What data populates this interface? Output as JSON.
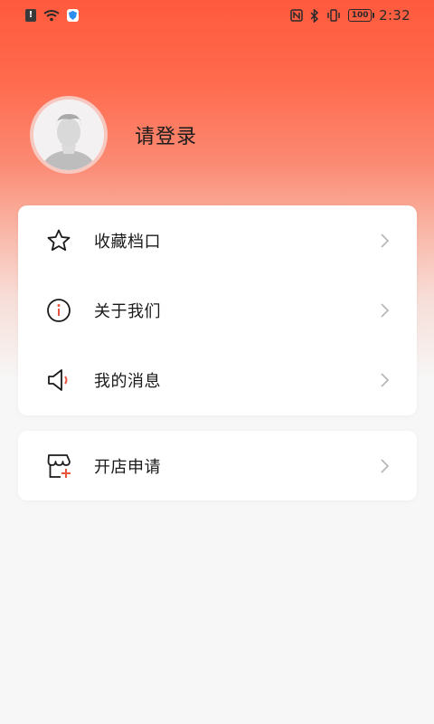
{
  "status_bar": {
    "alert_glyph": "!",
    "battery": "100",
    "time": "2:32"
  },
  "profile": {
    "login_label": "请登录"
  },
  "menu": {
    "items": [
      {
        "label": "收藏档口",
        "icon": "star-icon"
      },
      {
        "label": "关于我们",
        "icon": "info-circle-icon"
      },
      {
        "label": "我的消息",
        "icon": "speaker-icon"
      }
    ],
    "shop_apply": {
      "label": "开店申请",
      "icon": "store-add-icon"
    }
  },
  "colors": {
    "hero_top": "#ff5a3d",
    "background": "#f7f7f7",
    "accent": "#e8553e",
    "avatar_ring": "#f7c8bf"
  }
}
